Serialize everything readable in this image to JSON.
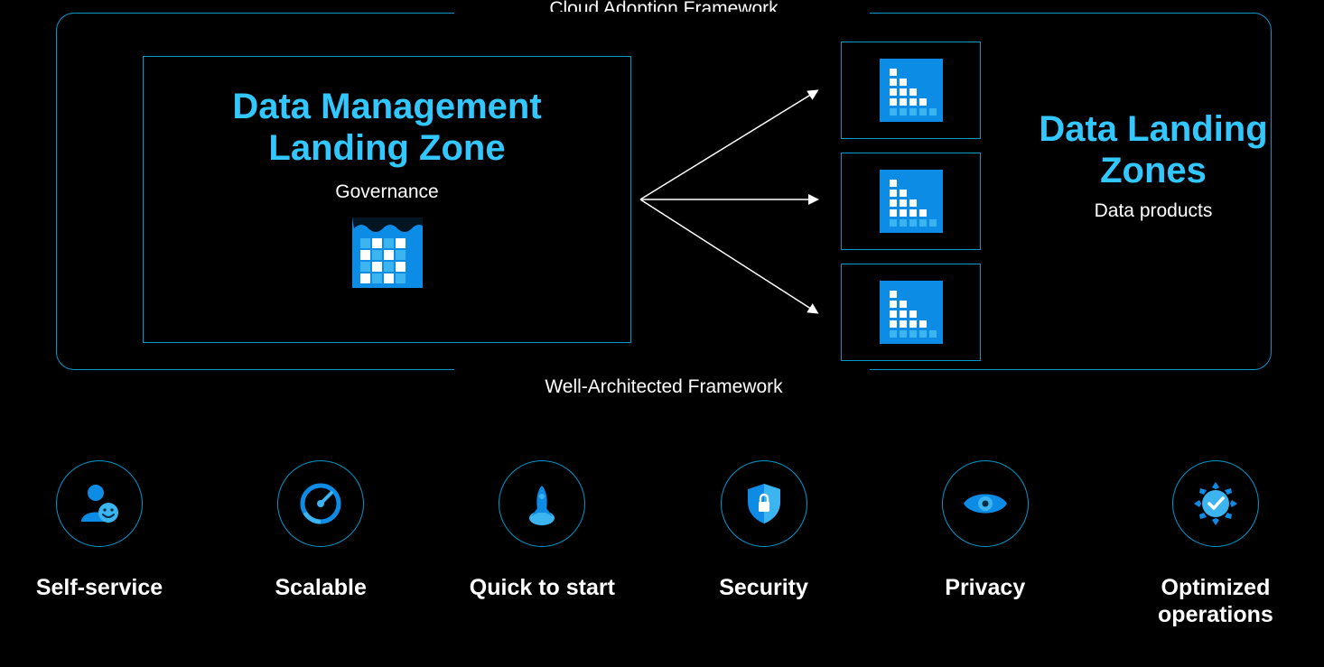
{
  "framework": {
    "top_label": "Cloud Adoption Framework",
    "bottom_label": "Well-Architected Framework",
    "data_management": {
      "title_line1": "Data Management",
      "title_line2": "Landing Zone",
      "subtitle": "Governance",
      "icon": "data-lake-icon"
    },
    "data_landing": {
      "title_line1": "Data Landing",
      "title_line2": "Zones",
      "subtitle": "Data products",
      "zone_icon": "landing-zone-icon",
      "zone_count": 3
    }
  },
  "features": [
    {
      "label": "Self-service",
      "icon": "self-service-icon"
    },
    {
      "label": "Scalable",
      "icon": "gauge-icon"
    },
    {
      "label": "Quick to start",
      "icon": "rocket-icon"
    },
    {
      "label": "Security",
      "icon": "shield-lock-icon"
    },
    {
      "label": "Privacy",
      "icon": "eye-icon"
    },
    {
      "label": "Optimized operations",
      "icon": "gear-check-icon"
    }
  ],
  "colors": {
    "accent": "#32c8ff",
    "border": "#0099cc",
    "icon_fill": "#0d8ce6",
    "icon_fill_light": "#3cb4f0",
    "background": "#000000"
  }
}
